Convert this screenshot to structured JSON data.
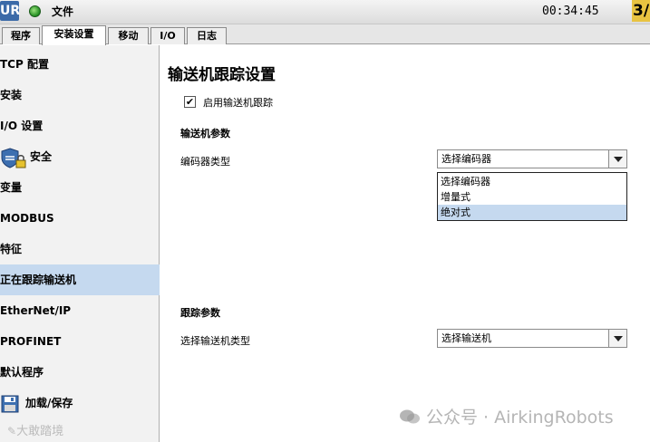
{
  "titlebar": {
    "logo_text": "UR",
    "file_label": "文件",
    "clock": "00:34:45",
    "speed": "3/"
  },
  "tabs": [
    {
      "label": "程序"
    },
    {
      "label": "安装设置"
    },
    {
      "label": "移动"
    },
    {
      "label": "I/O"
    },
    {
      "label": "日志"
    }
  ],
  "sidebar": {
    "items": [
      {
        "label": "TCP 配置"
      },
      {
        "label": "安装"
      },
      {
        "label": "I/O 设置"
      },
      {
        "label": "安全"
      },
      {
        "label": "变量"
      },
      {
        "label": "MODBUS"
      },
      {
        "label": "特征"
      },
      {
        "label": "正在跟踪输送机"
      },
      {
        "label": "EtherNet/IP"
      },
      {
        "label": "PROFINET"
      },
      {
        "label": "默认程序"
      },
      {
        "label": "加载/保存"
      }
    ],
    "selected_index": 7
  },
  "main": {
    "title": "输送机跟踪设置",
    "enable_checkbox": {
      "label": "启用输送机跟踪",
      "checked": true
    },
    "conveyor_section": "输送机参数",
    "encoder_type_label": "编码器类型",
    "encoder_select_value": "选择编码器",
    "encoder_options": [
      "选择编码器",
      "增量式",
      "绝对式"
    ],
    "encoder_highlighted_index": 2,
    "tracking_section": "跟踪参数",
    "conveyor_type_label": "选择输送机类型",
    "conveyor_select_value": "选择输送机"
  },
  "watermarks": {
    "right": "公众号 · AirkingRobots",
    "left": "大敢踏境"
  },
  "colors": {
    "selected_bg": "#c5d9ef",
    "speed_bg": "#e8c341",
    "status_dot": "#1f8b1f"
  }
}
